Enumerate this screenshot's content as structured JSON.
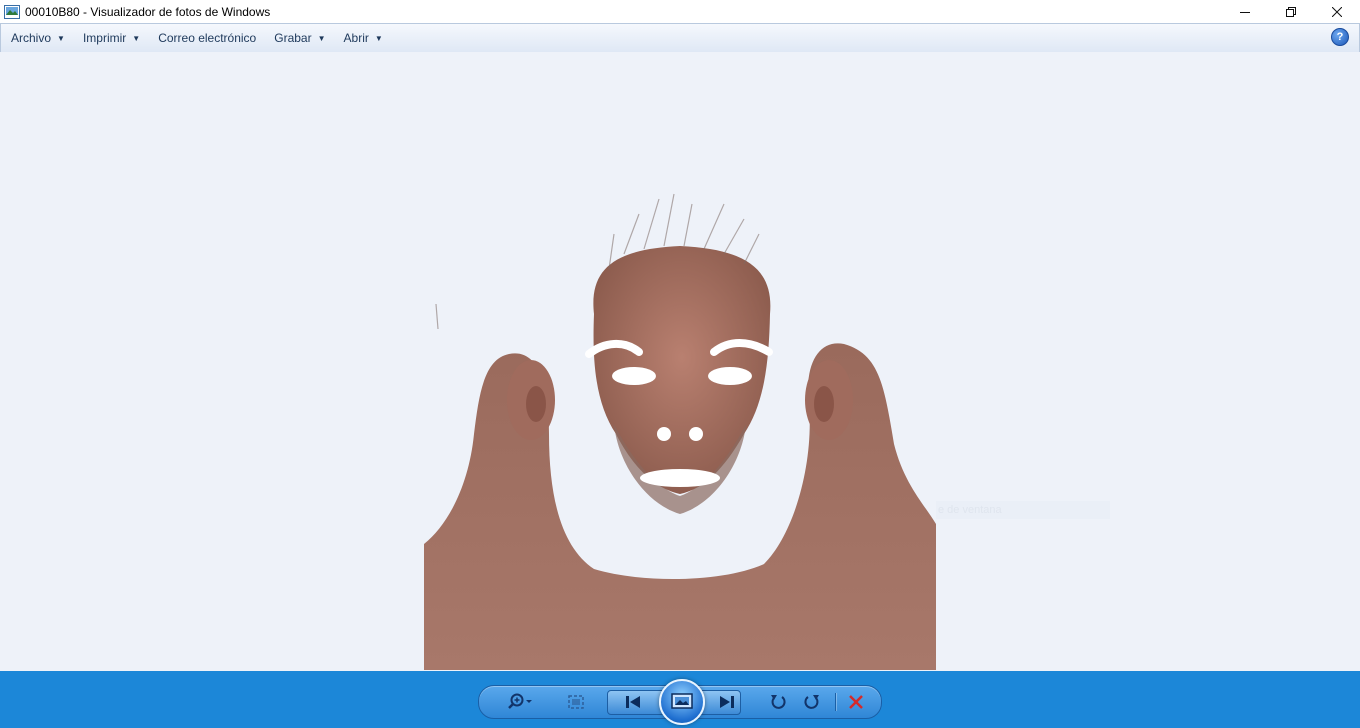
{
  "window": {
    "title": "00010B80 - Visualizador de fotos de Windows",
    "controls": {
      "minimize": "—",
      "restore": "❐",
      "close": "✕"
    }
  },
  "menu": {
    "items": [
      {
        "label": "Archivo",
        "has_dropdown": true
      },
      {
        "label": "Imprimir",
        "has_dropdown": true
      },
      {
        "label": "Correo electrónico",
        "has_dropdown": false
      },
      {
        "label": "Grabar",
        "has_dropdown": true
      },
      {
        "label": "Abrir",
        "has_dropdown": true
      }
    ],
    "help": "?"
  },
  "viewer": {
    "ghost_text": "e de ventana"
  },
  "toolbar": {
    "buttons": [
      "zoom-icon",
      "fit-window-icon",
      "previous-icon",
      "slideshow-icon",
      "next-icon",
      "rotate-left-icon",
      "rotate-right-icon",
      "delete-icon"
    ]
  },
  "colors": {
    "titlebar": "#ffffff",
    "menubar": "#dfe8f5",
    "viewer_bg": "#eef2f9",
    "bottombar": "#1c87d8",
    "skin": "#a07060",
    "delete": "#d42a2a"
  }
}
